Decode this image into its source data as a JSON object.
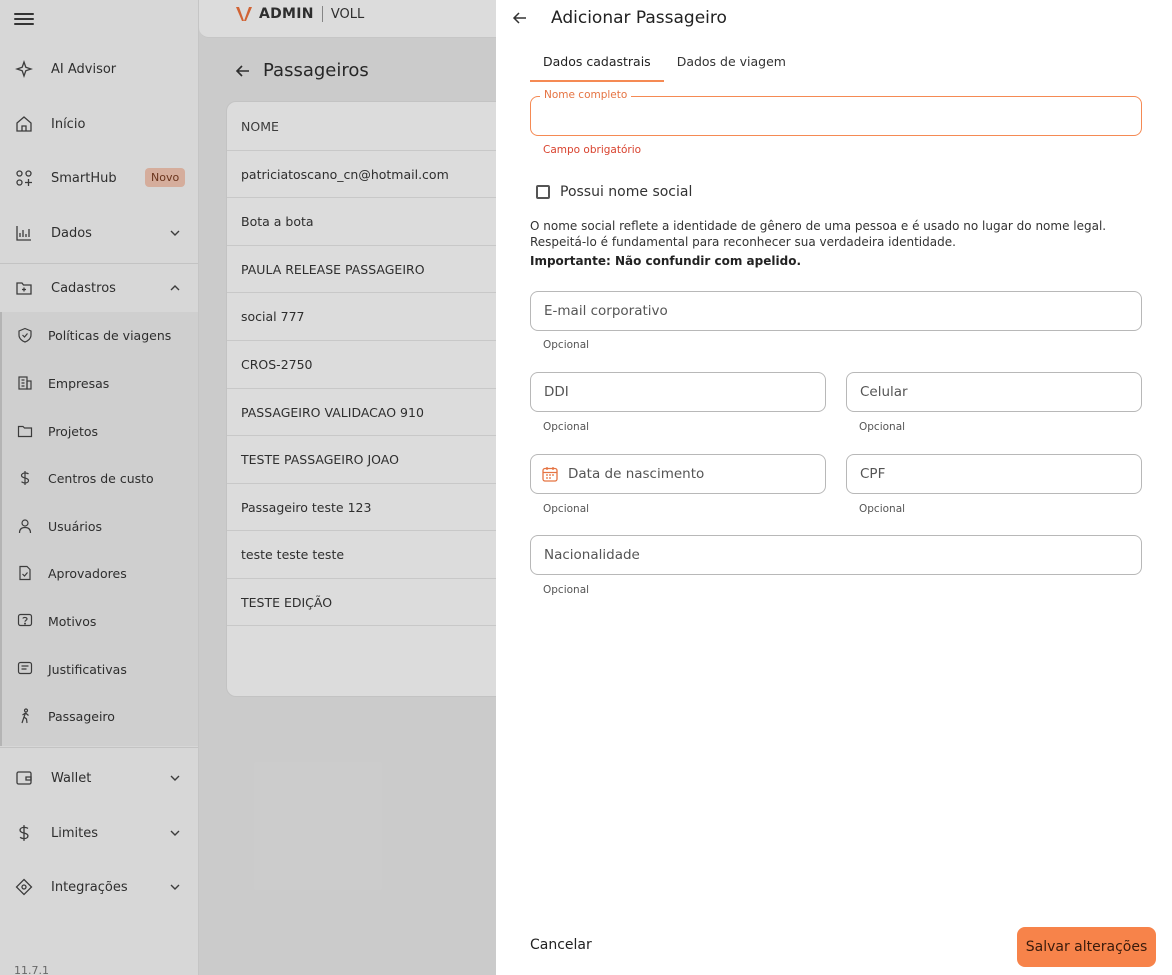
{
  "sidebar": {
    "items": [
      {
        "label": "AI Advisor"
      },
      {
        "label": "Início"
      },
      {
        "label": "SmartHub",
        "badge": "Novo"
      },
      {
        "label": "Dados"
      },
      {
        "label": "Cadastros"
      }
    ],
    "sub_items": [
      {
        "label": "Políticas de viagens"
      },
      {
        "label": "Empresas"
      },
      {
        "label": "Projetos"
      },
      {
        "label": "Centros de custo"
      },
      {
        "label": "Usuários"
      },
      {
        "label": "Aprovadores"
      },
      {
        "label": "Motivos"
      },
      {
        "label": "Justificativas"
      },
      {
        "label": "Passageiro"
      }
    ],
    "bottom_items": [
      {
        "label": "Wallet"
      },
      {
        "label": "Limites"
      },
      {
        "label": "Integrações"
      }
    ],
    "version": "11.7.1"
  },
  "topbar": {
    "admin": "ADMIN",
    "brand": "VOLL"
  },
  "page": {
    "title": "Passageiros",
    "column_header": "NOME",
    "rows": [
      "patriciatoscano_cn@hotmail.com",
      "Bota a bota",
      "PAULA RELEASE PASSAGEIRO",
      "social 777",
      "CROS-2750",
      "PASSAGEIRO VALIDACAO 910",
      "TESTE PASSAGEIRO JOAO",
      "Passageiro teste 123",
      "teste teste teste",
      "TESTE EDIÇÃO"
    ]
  },
  "drawer": {
    "title": "Adicionar Passageiro",
    "tabs": [
      "Dados cadastrais",
      "Dados de viagem"
    ],
    "name_field": {
      "label": "Nome completo",
      "value": "",
      "error": "Campo obrigatório"
    },
    "social_checkbox": {
      "label": "Possui nome social",
      "checked": false
    },
    "info_text": "O nome social reflete a identidade de gênero de uma pessoa e é usado no lugar do nome legal. Respeitá-lo é fundamental para reconhecer sua verdadeira identidade.",
    "info_strong": "Importante: Não confundir com apelido.",
    "fields": {
      "email": {
        "placeholder": "E-mail corporativo",
        "helper": "Opcional"
      },
      "ddi": {
        "placeholder": "DDI",
        "helper": "Opcional"
      },
      "celular": {
        "placeholder": "Celular",
        "helper": "Opcional"
      },
      "birth": {
        "placeholder": "Data de nascimento",
        "helper": "Opcional"
      },
      "cpf": {
        "placeholder": "CPF",
        "helper": "Opcional"
      },
      "nationality": {
        "placeholder": "Nacionalidade",
        "helper": "Opcional"
      }
    },
    "cancel_label": "Cancelar",
    "save_label": "Salvar alterações"
  },
  "colors": {
    "accent": "#f7834a",
    "error": "#d9432f",
    "badge_bg": "#f7c8b4"
  }
}
